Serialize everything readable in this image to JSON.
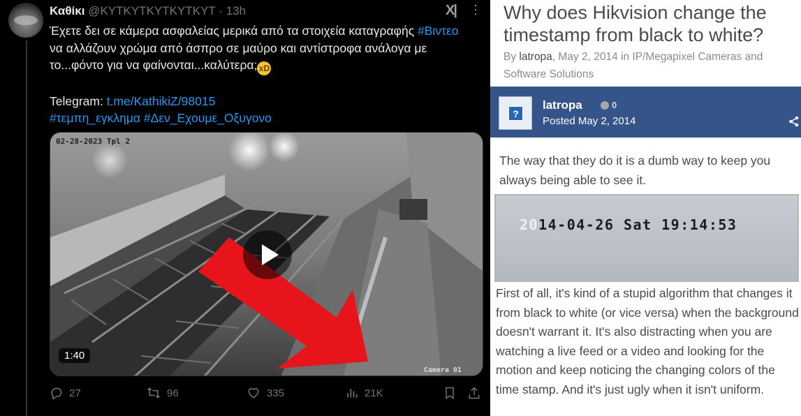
{
  "tweet": {
    "display_name": "Καθίκι",
    "handle": "@KYTKYTKYTKYTKYT",
    "time": "· 13h",
    "logo_label": "X|",
    "more_label": "⋮",
    "text_lines": [
      {
        "pre": "Έχετε δει σε κάμερα ασφαλείας μερικά από τα στοιχεία καταγραφής ",
        "hashtag": "#Βιντεο"
      },
      {
        "pre": "να αλλάζουν χρώμα από άσπρο σε μαύρο και αντίστροφα ανάλογα με"
      },
      {
        "pre": "το...φόντο για να φαίνονται...καλύτερα;",
        "emoji": "xD"
      }
    ],
    "telegram_label": "Telegram: ",
    "telegram_link": "t.me/KathikiZ/98015",
    "hashtags": "#τεμπη_εγκλημα #Δεν_Εχουμε_Οξυγονο",
    "video": {
      "duration": "1:40",
      "timestamp_overlay": "02-28-2023 Tpl 2",
      "camera_label": "Camera 01"
    },
    "actions": {
      "replies": "27",
      "retweets": "96",
      "likes": "335",
      "views": "21K"
    },
    "colors": {
      "link": "#1d9bf0",
      "text": "#e7e9ea",
      "muted": "#71767b",
      "arrow": "#e8141b"
    }
  },
  "forum": {
    "title": "Why does Hikvision change the timestamp from black to white?",
    "meta": {
      "by_label": "By ",
      "author": "latropa",
      "date_text": ", May 2, 2014 in ",
      "category": "IP/Megapixel Cameras and Software Solutions"
    },
    "post": {
      "author": "latropa",
      "reputation": "0",
      "posted_label": "Posted ",
      "posted_date": "May 2, 2014",
      "avatar_glyph": "?"
    },
    "paragraph_1": "The way that they do it is a dumb way to keep you always being able to see it.",
    "snapshot": {
      "lead": "20",
      "rest": "14-04-26 Sat 19:14:53"
    },
    "paragraph_2": "First of all, it's kind of a stupid algorithm that changes it from black to white (or vice versa) when the background doesn't warrant it. It's also distracting when you are watching a live feed or a video and looking for the motion and keep noticing the changing colors of the time stamp. And it's just ugly when it isn't uniform.",
    "colors": {
      "header_bar": "#34548a",
      "text": "#4a4a4a",
      "meta": "#8a8a8a"
    }
  }
}
